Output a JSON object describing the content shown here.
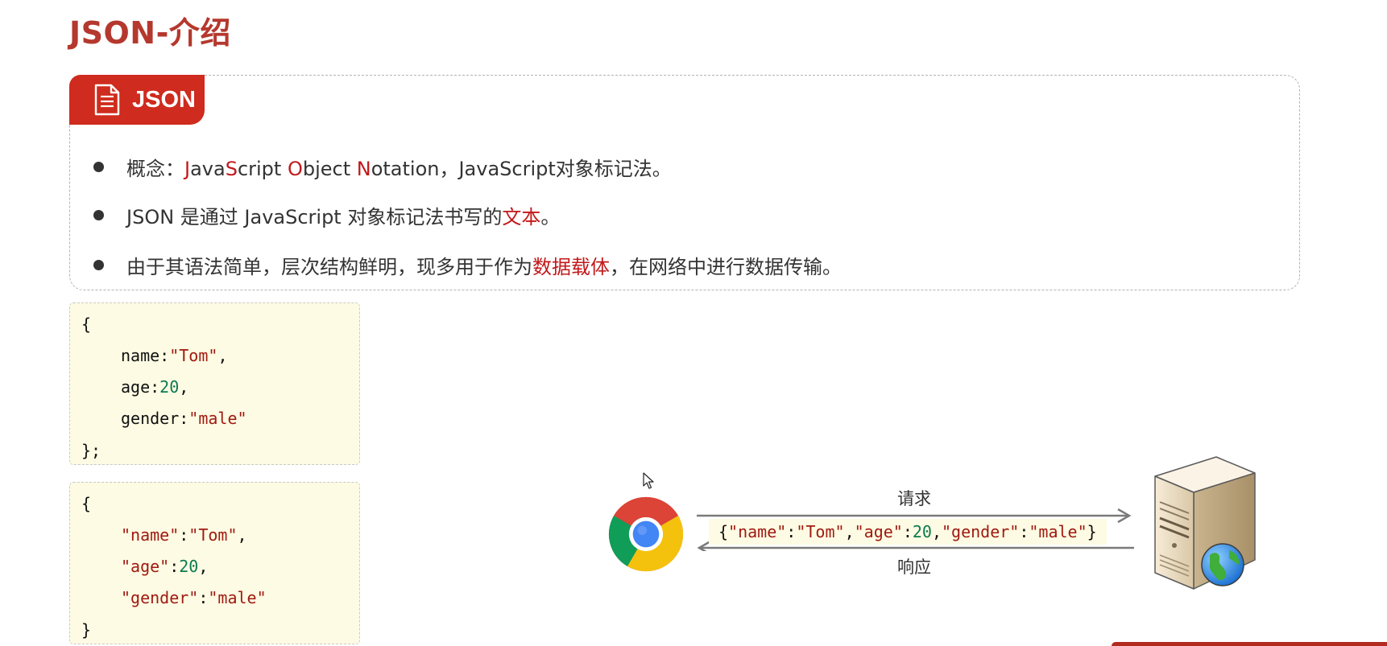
{
  "page_title": "JSON-介绍",
  "section_tab": {
    "label": "JSON",
    "icon": "document-icon"
  },
  "bullets": [
    {
      "parts": [
        {
          "text": "概念：",
          "red": false
        },
        {
          "text": "J",
          "red": true
        },
        {
          "text": "ava",
          "red": false
        },
        {
          "text": "S",
          "red": true
        },
        {
          "text": "cript ",
          "red": false
        },
        {
          "text": "O",
          "red": true
        },
        {
          "text": "bject ",
          "red": false
        },
        {
          "text": "N",
          "red": true
        },
        {
          "text": "otation，JavaScript对象标记法。",
          "red": false
        }
      ]
    },
    {
      "parts": [
        {
          "text": "JSON 是通过 JavaScript 对象标记法书写的",
          "red": false
        },
        {
          "text": "文本",
          "red": true
        },
        {
          "text": "。",
          "red": false
        }
      ]
    },
    {
      "parts": [
        {
          "text": "由于其语法简单，层次结构鲜明，现多用于作为",
          "red": false
        },
        {
          "text": "数据载体",
          "red": true
        },
        {
          "text": "，在网络中进行数据传输。",
          "red": false
        }
      ]
    }
  ],
  "code_js_object": {
    "open": "{",
    "lines": [
      {
        "key": "name:",
        "value": "\"Tom\"",
        "value_type": "string",
        "trail": ","
      },
      {
        "key": "age:",
        "value": "20",
        "value_type": "number",
        "trail": ","
      },
      {
        "key": "gender:",
        "value": "\"male\"",
        "value_type": "string",
        "trail": ""
      }
    ],
    "close": "};"
  },
  "code_json": {
    "open": "{",
    "lines": [
      {
        "key": "\"name\"",
        "sep": ":",
        "value": "\"Tom\"",
        "value_type": "string",
        "trail": ","
      },
      {
        "key": "\"age\"",
        "sep": ":",
        "value": "20",
        "value_type": "number",
        "trail": ","
      },
      {
        "key": "\"gender\"",
        "sep": ":",
        "value": "\"male\"",
        "value_type": "string",
        "trail": ""
      }
    ],
    "close": "}"
  },
  "diagram": {
    "request_label": "请求",
    "response_label": "响应",
    "payload": [
      {
        "t": "{",
        "c": "plain"
      },
      {
        "t": "\"name\"",
        "c": "str"
      },
      {
        "t": ":",
        "c": "plain"
      },
      {
        "t": "\"Tom\"",
        "c": "str"
      },
      {
        "t": ",",
        "c": "plain"
      },
      {
        "t": "\"age\"",
        "c": "str"
      },
      {
        "t": ":",
        "c": "plain"
      },
      {
        "t": "20",
        "c": "num"
      },
      {
        "t": ",",
        "c": "plain"
      },
      {
        "t": "\"gender\"",
        "c": "str"
      },
      {
        "t": ":",
        "c": "plain"
      },
      {
        "t": "\"male\"",
        "c": "str"
      },
      {
        "t": "}",
        "c": "plain"
      }
    ],
    "client_icon": "chrome-browser-icon",
    "server_icon": "web-server-icon"
  },
  "colors": {
    "title": "#b5382e",
    "accent_red": "#cf2b1e",
    "highlight_text": "#c2191b",
    "code_bg": "#fdfbe3",
    "code_string": "#a01a12",
    "code_number": "#0b7a52"
  }
}
